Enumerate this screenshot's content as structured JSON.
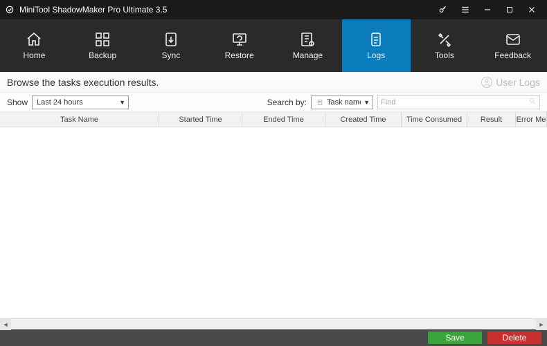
{
  "app": {
    "title": "MiniTool ShadowMaker Pro Ultimate 3.5"
  },
  "nav": {
    "items": [
      {
        "label": "Home"
      },
      {
        "label": "Backup"
      },
      {
        "label": "Sync"
      },
      {
        "label": "Restore"
      },
      {
        "label": "Manage"
      },
      {
        "label": "Logs"
      },
      {
        "label": "Tools"
      },
      {
        "label": "Feedback"
      }
    ],
    "active_index": 5
  },
  "subheader": {
    "heading": "Browse the tasks execution results.",
    "user_logs_label": "User Logs"
  },
  "filter": {
    "show_label": "Show",
    "show_value": "Last 24 hours",
    "search_by_label": "Search by:",
    "search_by_value": "Task name",
    "find_placeholder": "Find"
  },
  "columns": {
    "task": "Task Name",
    "started": "Started Time",
    "ended": "Ended Time",
    "created": "Created Time",
    "consumed": "Time Consumed",
    "result": "Result",
    "error": "Error Me"
  },
  "footer": {
    "save": "Save",
    "delete": "Delete"
  }
}
